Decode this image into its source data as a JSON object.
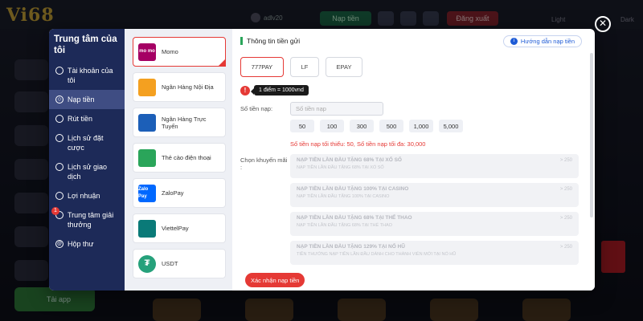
{
  "site": {
    "logo": "Vi68",
    "username": "adlv20",
    "deposit_btn": "Nạp tiền",
    "logout_btn": "Đăng xuất",
    "light_label": "Light",
    "dark_label": "Dark",
    "bottom_green_label": "Tải app"
  },
  "sidebar": {
    "title": "Trung tâm của tôi",
    "items": [
      {
        "label": "Tài khoản của tôi",
        "icon": "account-icon"
      },
      {
        "label": "Nạp tiền",
        "icon": "deposit-icon"
      },
      {
        "label": "Rút tiền",
        "icon": "withdraw-icon"
      },
      {
        "label": "Lịch sử đặt cược",
        "icon": "bet-history-icon"
      },
      {
        "label": "Lịch sử giao dịch",
        "icon": "transaction-history-icon"
      },
      {
        "label": "Lợi nhuận",
        "icon": "profit-icon"
      },
      {
        "label": "Trung tâm giải thưởng",
        "icon": "reward-icon",
        "badge": "1"
      },
      {
        "label": "Hộp thư",
        "icon": "mail-icon"
      }
    ]
  },
  "methods": [
    {
      "label": "Momo",
      "logo_text": "mo mo"
    },
    {
      "label": "Ngân Hàng Nội Địa",
      "logo_text": ""
    },
    {
      "label": "Ngân Hàng Trực Tuyến",
      "logo_text": ""
    },
    {
      "label": "Thẻ cào điện thoại",
      "logo_text": ""
    },
    {
      "label": "ZaloPay",
      "logo_text": "Zalo Pay"
    },
    {
      "label": "ViettelPay",
      "logo_text": ""
    },
    {
      "label": "USDT",
      "logo_text": "₮"
    }
  ],
  "content": {
    "title": "Thông tin tiền gửi",
    "guide": "Hướng dẫn nạp tiền",
    "channels": [
      "777PAY",
      "LF",
      "EPAY"
    ],
    "rate_tooltip": "1 điểm = 1000vnd",
    "amount_label": "Số tiền nạp:",
    "amount_placeholder": "Số tiền nạp",
    "quick_amounts": [
      "50",
      "100",
      "300",
      "500",
      "1,000",
      "5,000"
    ],
    "limits": "Số tiền nạp tối thiểu:  50,   Số tiền nạp tối đa:  30,000",
    "promo_label": "Chọn khuyến mãi :",
    "promos": [
      {
        "title": "NẠP TIỀN LẦN ĐẦU TẶNG 68% TẠI XỔ SỐ",
        "sub": "NẠP TIỀN LẦN ĐẦU TẶNG 68% TẠI XỔ SỐ",
        "arrow": "> 250"
      },
      {
        "title": "NẠP TIỀN LẦN ĐẦU TẶNG 100% TẠI CASINO",
        "sub": "NẠP TIỀN LẦN ĐẦU TẶNG 100% TẠI CASINO",
        "arrow": "> 250"
      },
      {
        "title": "NẠP TIỀN LẦN ĐẦU TẶNG 68% TẠI THỂ THAO",
        "sub": "NẠP TIỀN LẦN ĐẦU TẶNG 68% TẠI THỂ THAO",
        "arrow": "> 250"
      },
      {
        "title": "NẠP TIỀN LẦN ĐẦU TẶNG 129% TẠI NỔ HŨ",
        "sub": "TIỀN THƯỞNG NẠP TIỀN LẦN ĐẦU DÀNH CHO THÀNH VIÊN MỚI TẠI NỔ HŨ",
        "arrow": "> 250"
      }
    ],
    "confirm": "Xác nhận nạp tiền"
  }
}
